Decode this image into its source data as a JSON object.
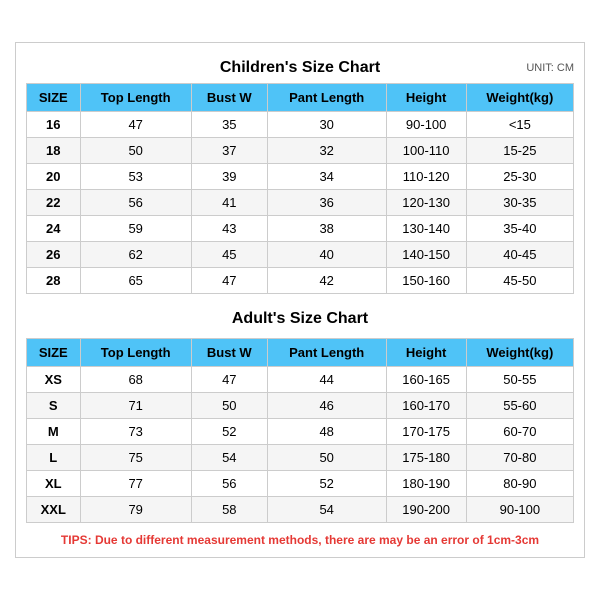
{
  "children": {
    "title": "Children's Size Chart",
    "unit": "UNIT: CM",
    "headers": [
      "SIZE",
      "Top Length",
      "Bust W",
      "Pant Length",
      "Height",
      "Weight(kg)"
    ],
    "rows": [
      [
        "16",
        "47",
        "35",
        "30",
        "90-100",
        "<15"
      ],
      [
        "18",
        "50",
        "37",
        "32",
        "100-110",
        "15-25"
      ],
      [
        "20",
        "53",
        "39",
        "34",
        "110-120",
        "25-30"
      ],
      [
        "22",
        "56",
        "41",
        "36",
        "120-130",
        "30-35"
      ],
      [
        "24",
        "59",
        "43",
        "38",
        "130-140",
        "35-40"
      ],
      [
        "26",
        "62",
        "45",
        "40",
        "140-150",
        "40-45"
      ],
      [
        "28",
        "65",
        "47",
        "42",
        "150-160",
        "45-50"
      ]
    ]
  },
  "adults": {
    "title": "Adult's Size Chart",
    "headers": [
      "SIZE",
      "Top Length",
      "Bust W",
      "Pant Length",
      "Height",
      "Weight(kg)"
    ],
    "rows": [
      [
        "XS",
        "68",
        "47",
        "44",
        "160-165",
        "50-55"
      ],
      [
        "S",
        "71",
        "50",
        "46",
        "160-170",
        "55-60"
      ],
      [
        "M",
        "73",
        "52",
        "48",
        "170-175",
        "60-70"
      ],
      [
        "L",
        "75",
        "54",
        "50",
        "175-180",
        "70-80"
      ],
      [
        "XL",
        "77",
        "56",
        "52",
        "180-190",
        "80-90"
      ],
      [
        "XXL",
        "79",
        "58",
        "54",
        "190-200",
        "90-100"
      ]
    ]
  },
  "tips": {
    "label": "TIPS:",
    "text": " Due to different measurement methods, there are may be an error of 1cm-3cm"
  }
}
